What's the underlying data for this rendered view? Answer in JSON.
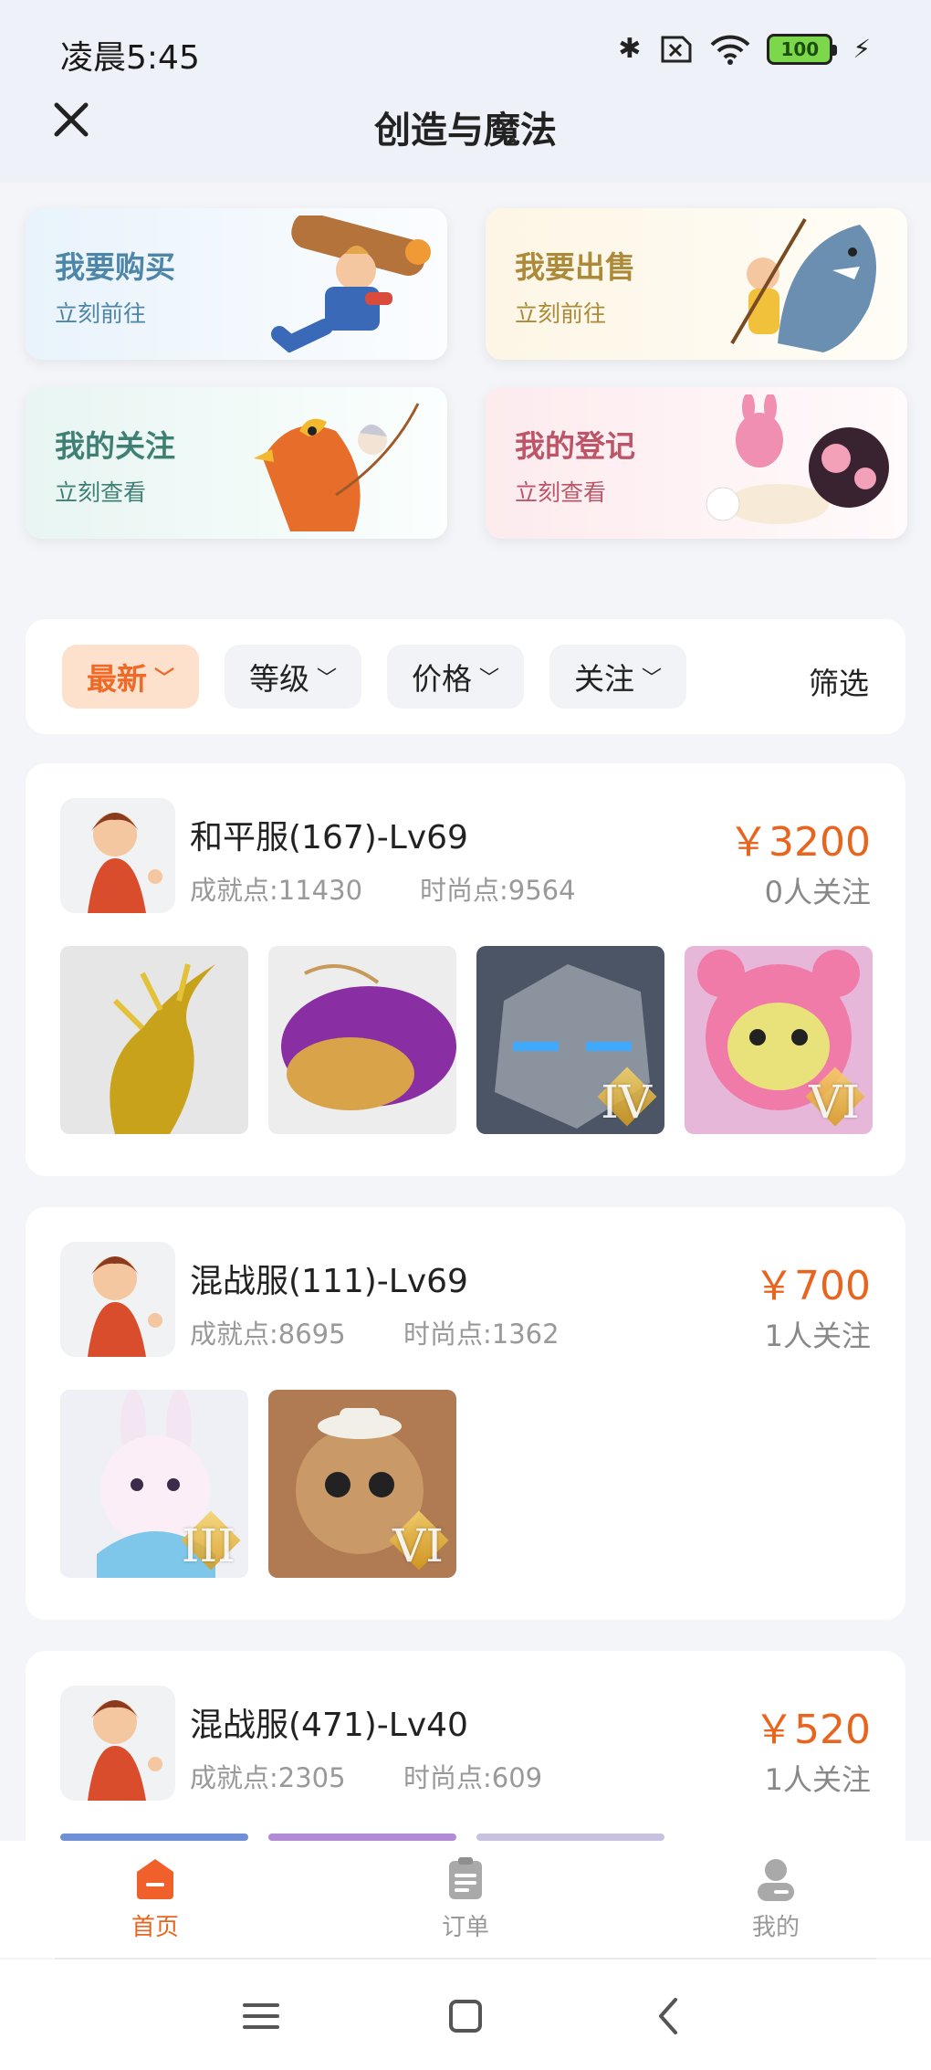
{
  "status": {
    "time": "凌晨5:45",
    "battery": "100"
  },
  "header": {
    "title": "创造与魔法"
  },
  "quick_cards": [
    {
      "title": "我要购买",
      "sub": "立刻前往"
    },
    {
      "title": "我要出售",
      "sub": "立刻前往"
    },
    {
      "title": "我的关注",
      "sub": "立刻查看"
    },
    {
      "title": "我的登记",
      "sub": "立刻查看"
    }
  ],
  "filters": {
    "latest": "最新",
    "level": "等级",
    "price": "价格",
    "follow": "关注",
    "screen": "筛选"
  },
  "listings": [
    {
      "title": "和平服(167)-Lv69",
      "achievement": "成就点:11430",
      "fashion": "时尚点:9564",
      "price": "￥3200",
      "followers": "0人关注",
      "tiers": [
        "",
        "",
        "IV",
        "VI"
      ]
    },
    {
      "title": "混战服(111)-Lv69",
      "achievement": "成就点:8695",
      "fashion": "时尚点:1362",
      "price": "￥700",
      "followers": "1人关注",
      "tiers": [
        "III",
        "VI"
      ]
    },
    {
      "title": "混战服(471)-Lv40",
      "achievement": "成就点:2305",
      "fashion": "时尚点:609",
      "price": "￥520",
      "followers": "1人关注"
    }
  ],
  "nav": {
    "home": "首页",
    "orders": "订单",
    "mine": "我的"
  },
  "colors": {
    "accent": "#e8651f",
    "chip_active_bg": "#fde1cd"
  }
}
